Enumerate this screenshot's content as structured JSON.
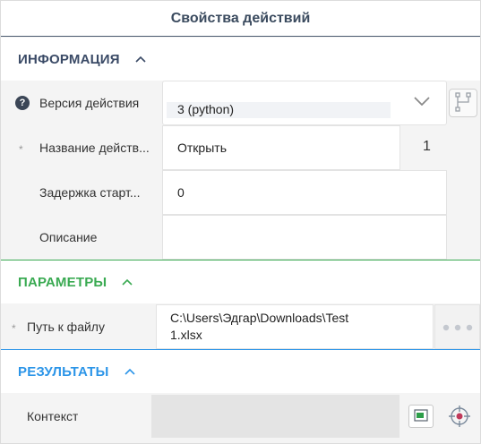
{
  "window": {
    "title": "Свойства действий"
  },
  "sections": {
    "info": {
      "label": "ИНФОРМАЦИЯ",
      "color": "#3a4a66"
    },
    "params": {
      "label": "ПАРАМЕТРЫ",
      "color": "#3aaa52"
    },
    "results": {
      "label": "РЕЗУЛЬТАТЫ",
      "color": "#2c95e8"
    }
  },
  "info": {
    "version": {
      "label": "Версия действия",
      "value": "3 (python)",
      "help": "?"
    },
    "name": {
      "label": "Название действ...",
      "value": "Открыть",
      "required": "*",
      "counter": "1"
    },
    "delay": {
      "label": "Задержка старт...",
      "value": "0"
    },
    "description": {
      "label": "Описание",
      "value": ""
    }
  },
  "params": {
    "file_path": {
      "label": "Путь к файлу",
      "value_line1": "C:\\Users\\Эдгар\\Downloads\\Test",
      "value_line2": "1.xlsx",
      "required": "*"
    }
  },
  "results": {
    "context": {
      "label": "Контекст",
      "value": ""
    }
  },
  "icons": {
    "collapse": "chevron-up-icon",
    "dropdown": "chevron-down-icon",
    "branch": "branch-icon",
    "more": "more-dots-icon",
    "variable": "variable-icon",
    "target": "target-icon"
  }
}
